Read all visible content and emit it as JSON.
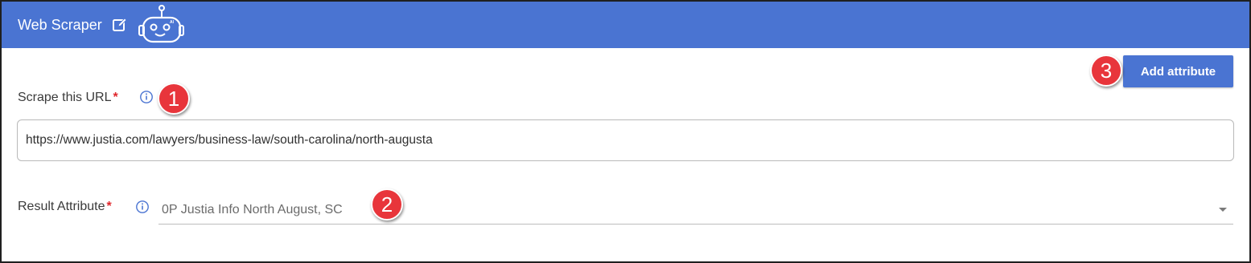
{
  "header": {
    "title": "Web Scraper",
    "edit_icon": "edit-icon",
    "robot_icon": "robot-ai-icon",
    "robot_badge": "AI",
    "color": "#4a74d2"
  },
  "toolbar": {
    "add_attribute_label": "Add attribute"
  },
  "url_field": {
    "label": "Scrape this URL",
    "required_marker": "*",
    "value": "https://www.justia.com/lawyers/business-law/south-carolina/north-augusta",
    "info_icon": "info-icon"
  },
  "result_field": {
    "label": "Result Attribute",
    "required_marker": "*",
    "selected": "0P Justia Info North August, SC",
    "info_icon": "info-icon"
  },
  "callouts": {
    "one": "1",
    "two": "2",
    "three": "3",
    "color": "#e8353b"
  }
}
